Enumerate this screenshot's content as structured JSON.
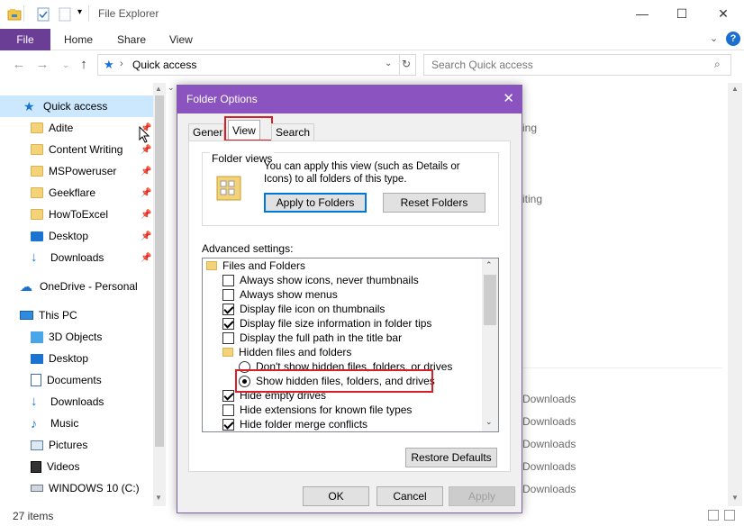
{
  "window": {
    "title": "File Explorer"
  },
  "ribbon": {
    "tabs": [
      "File",
      "Home",
      "Share",
      "View"
    ]
  },
  "address": {
    "path": "Quick access",
    "search_placeholder": "Search Quick access"
  },
  "sidebar": {
    "quick_access": "Quick access",
    "pinned": [
      "Adite",
      "Content Writing",
      "MSPoweruser",
      "Geekflare",
      "HowToExcel",
      "Desktop",
      "Downloads"
    ],
    "onedrive": "OneDrive - Personal",
    "this_pc": "This PC",
    "pc_items": [
      "3D Objects",
      "Desktop",
      "Documents",
      "Downloads",
      "Music",
      "Pictures",
      "Videos",
      "WINDOWS 10 (C:)"
    ]
  },
  "right_pane": {
    "partial_top": [
      "ing",
      "iting"
    ],
    "downloads": [
      "Downloads",
      "Downloads",
      "Downloads",
      "Downloads",
      "Downloads"
    ]
  },
  "status": {
    "items": "27 items"
  },
  "dialog": {
    "title": "Folder Options",
    "tabs": [
      "Genera",
      "View",
      "Search"
    ],
    "folder_views": {
      "label": "Folder views",
      "desc": "You can apply this view (such as Details or Icons) to all folders of this type.",
      "apply_btn": "Apply to Folders",
      "reset_btn": "Reset Folders"
    },
    "advanced_label": "Advanced settings:",
    "advanced_items": [
      {
        "type": "folder",
        "label": "Files and Folders",
        "indent": 0
      },
      {
        "type": "checkbox",
        "label": "Always show icons, never thumbnails",
        "checked": false,
        "indent": 1
      },
      {
        "type": "checkbox",
        "label": "Always show menus",
        "checked": false,
        "indent": 1
      },
      {
        "type": "checkbox",
        "label": "Display file icon on thumbnails",
        "checked": true,
        "indent": 1
      },
      {
        "type": "checkbox",
        "label": "Display file size information in folder tips",
        "checked": true,
        "indent": 1
      },
      {
        "type": "checkbox",
        "label": "Display the full path in the title bar",
        "checked": false,
        "indent": 1
      },
      {
        "type": "folder",
        "label": "Hidden files and folders",
        "indent": 1
      },
      {
        "type": "radio",
        "label": "Don't show hidden files, folders, or drives",
        "checked": false,
        "indent": 2
      },
      {
        "type": "radio",
        "label": "Show hidden files, folders, and drives",
        "checked": true,
        "indent": 2
      },
      {
        "type": "checkbox",
        "label": "Hide empty drives",
        "checked": true,
        "indent": 1
      },
      {
        "type": "checkbox",
        "label": "Hide extensions for known file types",
        "checked": false,
        "indent": 1
      },
      {
        "type": "checkbox",
        "label": "Hide folder merge conflicts",
        "checked": true,
        "indent": 1
      }
    ],
    "restore_btn": "Restore Defaults",
    "ok_btn": "OK",
    "cancel_btn": "Cancel",
    "apply_btn": "Apply"
  }
}
